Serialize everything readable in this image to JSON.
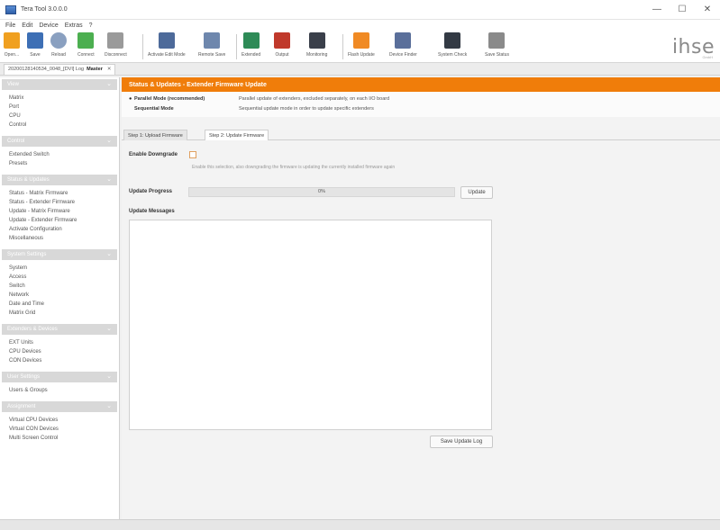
{
  "window": {
    "title": "Tera Tool 3.0.0.0",
    "controls": [
      "—",
      "☐",
      "✕"
    ]
  },
  "menu": [
    "File",
    "Edit",
    "Device",
    "Extras",
    "?"
  ],
  "toolbar": {
    "tools": [
      {
        "label": "Open...",
        "icon": "folder-open-icon",
        "color": "#f0a020"
      },
      {
        "label": "Save",
        "icon": "save-icon",
        "color": "#3d6fb5"
      },
      {
        "label": "Reload",
        "icon": "reload-icon",
        "color": "#8aa0c0"
      },
      {
        "label": "Connect",
        "icon": "connect-icon",
        "color": "#4caf50"
      },
      {
        "label": "Disconnect",
        "icon": "disconnect-icon",
        "color": "#9a9a9a"
      },
      {
        "label": "Activate Edit Mode",
        "icon": "edit-mode-icon",
        "color": "#4d6a9a"
      },
      {
        "label": "Remote Save",
        "icon": "remote-save-icon",
        "color": "#6e87ad"
      },
      {
        "label": "Extended",
        "icon": "extended-switch-icon",
        "color": "#2e8b57"
      },
      {
        "label": "Output",
        "icon": "output-switch-icon",
        "color": "#c0392b"
      },
      {
        "label": "Monitoring",
        "icon": "monitoring-icon",
        "color": "#3a3f4a"
      },
      {
        "label": "Flash Update",
        "icon": "flash-update-icon",
        "color": "#f08a24"
      },
      {
        "label": "Device Finder",
        "icon": "device-finder-icon",
        "color": "#5a6f9a"
      },
      {
        "label": "System Check",
        "icon": "system-check-icon",
        "color": "#333a44"
      },
      {
        "label": "Save Status",
        "icon": "save-status-icon",
        "color": "#8a8a8a"
      }
    ],
    "logo": "ihse",
    "logo_sub": "GmbH"
  },
  "doc_tab": {
    "name": "20200128140534_0048_[DVI] Log",
    "mode": "Master",
    "close": "✕"
  },
  "sidebar": {
    "sections": [
      {
        "title": "View",
        "items": [
          "Matrix",
          "Port",
          "CPU",
          "Control"
        ]
      },
      {
        "title": "Control",
        "items": [
          "Extended Switch",
          "Presets"
        ]
      },
      {
        "title": "Status & Updates",
        "items": [
          "Status - Matrix Firmware",
          "Status - Extender Firmware",
          "Update - Matrix Firmware",
          "Update - Extender Firmware",
          "Activate Configuration",
          "Miscellaneous"
        ]
      },
      {
        "title": "System Settings",
        "items": [
          "System",
          "Access",
          "Switch",
          "Network",
          "Date and Time",
          "Matrix Grid"
        ]
      },
      {
        "title": "Extenders & Devices",
        "items": [
          "EXT Units",
          "CPU Devices",
          "CON Devices"
        ]
      },
      {
        "title": "User Settings",
        "items": [
          "Users & Groups"
        ]
      },
      {
        "title": "Assignment",
        "items": [
          "Virtual CPU Devices",
          "Virtual CON Devices",
          "Multi Screen Control"
        ]
      }
    ],
    "chevron": "⌄"
  },
  "main": {
    "header": "Status & Updates - Extender Firmware Update",
    "modes": [
      {
        "bullet": "●",
        "name": "Parallel Mode (recommended)",
        "desc": "Parallel update of extenders, excluded separately, on each I/O board"
      },
      {
        "bullet": "",
        "name": "Sequential Mode",
        "desc": "Sequential update mode in order to update specific extenders"
      }
    ],
    "step_tabs": [
      "Step 1: Upload Firmware",
      "Step 2: Update Firmware"
    ],
    "downgrade_label": "Enable Downgrade",
    "downgrade_hint": "Enable this selection, also downgrading the firmware is updating the currently installed firmware again",
    "progress_label": "Update Progress",
    "progress_value": "0%",
    "progress_fraction": 0,
    "update_button": "Update",
    "messages_label": "Update Messages",
    "save_log_button": "Save Update Log"
  },
  "colors": {
    "accent": "#f07d0a",
    "section_header": "#d8d8d8"
  }
}
